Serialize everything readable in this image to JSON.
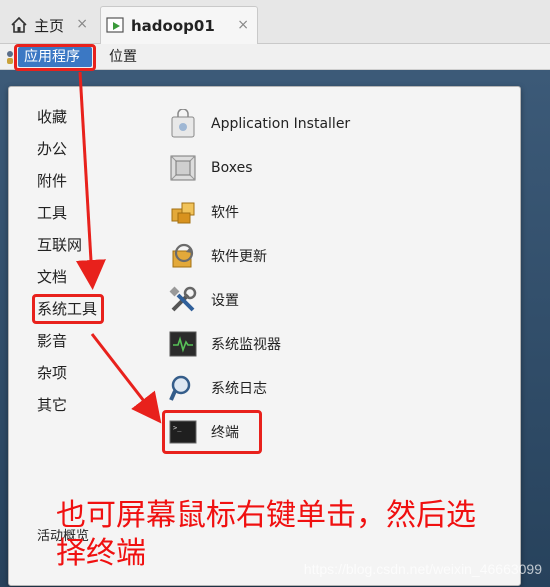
{
  "tabs": {
    "home_label": "主页",
    "vm_label": "hadoop01",
    "close_glyph": "×"
  },
  "menubar": {
    "applications": "应用程序",
    "places": "位置"
  },
  "categories": [
    "收藏",
    "办公",
    "附件",
    "工具",
    "互联网",
    "文档",
    "系统工具",
    "影音",
    "杂项",
    "其它",
    "活动概览"
  ],
  "apps": [
    {
      "label": "Application Installer",
      "icon": "shopping-bag-icon"
    },
    {
      "label": "Boxes",
      "icon": "boxes-icon"
    },
    {
      "label": "软件",
      "icon": "software-icon"
    },
    {
      "label": "软件更新",
      "icon": "software-update-icon"
    },
    {
      "label": "设置",
      "icon": "settings-tools-icon"
    },
    {
      "label": "系统监视器",
      "icon": "system-monitor-icon"
    },
    {
      "label": "系统日志",
      "icon": "system-log-icon"
    },
    {
      "label": "终端",
      "icon": "terminal-icon"
    }
  ],
  "annotation": {
    "line1": "也可屏幕鼠标右键单击，然后选",
    "line2": "择终端",
    "color": "#f01010"
  },
  "watermark": "https://blog.csdn.net/weixin_46663099"
}
